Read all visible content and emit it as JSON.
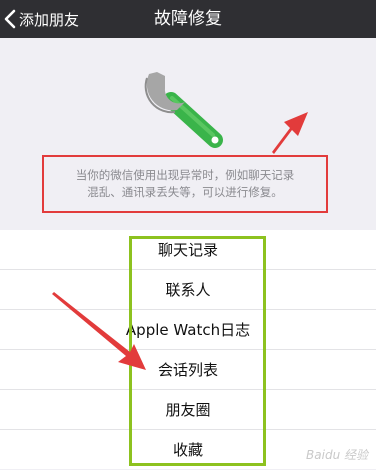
{
  "navbar": {
    "back_label": "添加朋友",
    "title": "故障修复"
  },
  "description": {
    "line1": "当你的微信使用出现异常时，例如聊天记录",
    "line2": "混乱、通讯录丢失等，可以进行修复。"
  },
  "repair_options": [
    {
      "label": "聊天记录"
    },
    {
      "label": "联系人"
    },
    {
      "label": "Apple Watch日志"
    },
    {
      "label": "会话列表"
    },
    {
      "label": "朋友圈"
    },
    {
      "label": "收藏"
    }
  ],
  "watermark": "Baidu 经验",
  "colors": {
    "navbar_bg": "#2f2f33",
    "page_bg": "#f0eff4",
    "annotation_red": "#e23b3b",
    "annotation_green": "#8dc21f",
    "wrench_green": "#3ab44a",
    "wrench_gray": "#a6a6a6"
  },
  "icons": {
    "back": "chevron-left-icon",
    "repair": "wrench-icon"
  }
}
